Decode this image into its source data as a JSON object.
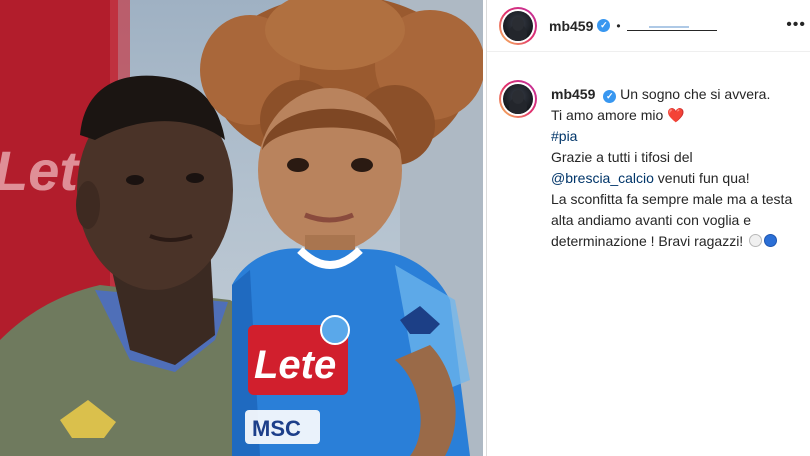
{
  "photo": {
    "jersey_sponsor": "Lete",
    "jersey_partner": "MSC",
    "banner_text": "Lete"
  },
  "post_header": {
    "username": "mb459",
    "separator": "•",
    "more_icon": "more-horizontal-icon"
  },
  "caption": {
    "username": "mb459",
    "line1": "Un sogno che si avvera.",
    "line2": "Ti amo amore mio",
    "hashtag": "#pia",
    "line4": "Grazie a tutti i tifosi del",
    "mention": "@brescia_calcio",
    "line5_rest": " venuti fun qua!",
    "line6": "La sconfitta fa sempre male ma a testa alta andiamo avanti con voglia e determinazione ! Bravi ragazzi!"
  },
  "colors": {
    "verified": "#3897f0",
    "link": "#003569",
    "napoli_blue": "#2a7fd8"
  }
}
